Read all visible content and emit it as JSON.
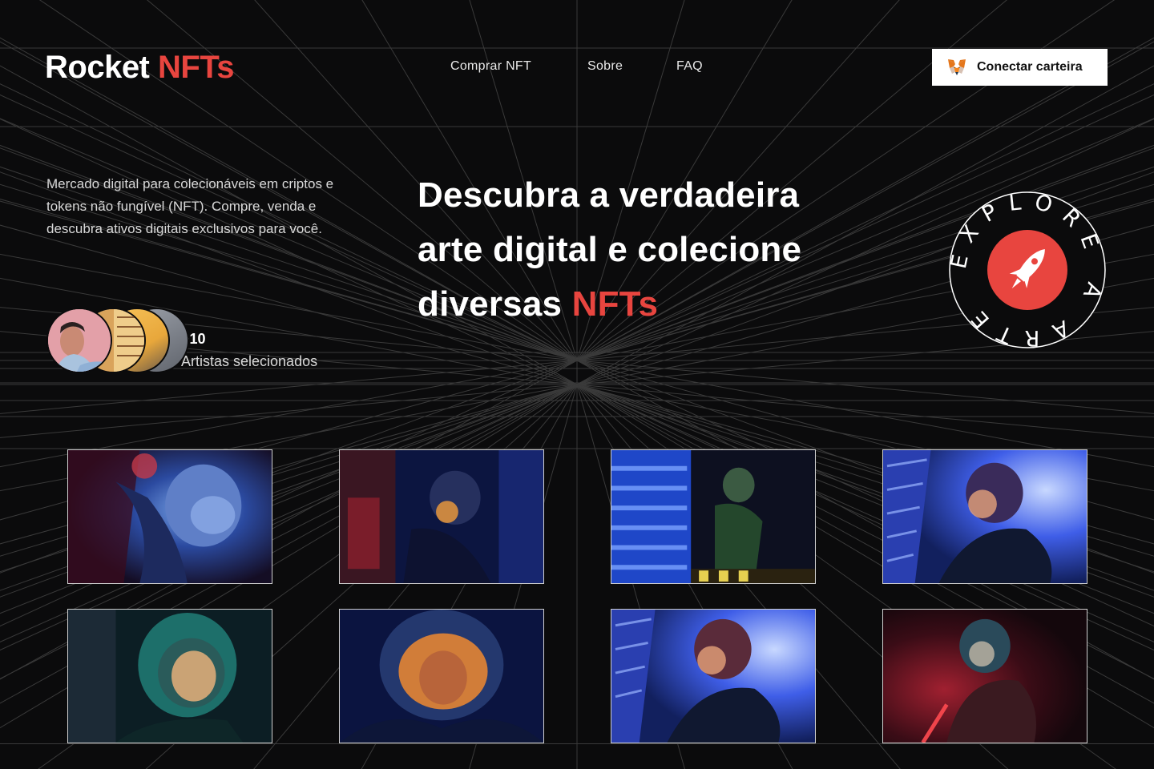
{
  "brand": {
    "name": "Rocket",
    "accent": "NFTs",
    "accent_color": "#e8453f"
  },
  "nav": {
    "items": [
      {
        "label": "Comprar NFT"
      },
      {
        "label": "Sobre"
      },
      {
        "label": "FAQ"
      }
    ]
  },
  "wallet": {
    "label": "Conectar carteira",
    "icon": "metamask-fox-icon"
  },
  "intro": {
    "text": "Mercado digital para colecionáveis em criptos e tokens não fungível (NFT). Compre, venda e descubra ativos digitais exclusivos para você."
  },
  "artists": {
    "count": "+10",
    "label": "Artistas selecionados"
  },
  "hero": {
    "line1": "Descubra a verdadeira",
    "line2": "arte digital e colecione",
    "line3_prefix": "diversas",
    "line3_accent": "NFTs"
  },
  "badge": {
    "text": "EXPLORE A ARTE",
    "icon": "rocket-icon"
  },
  "gallery": {
    "items": [
      {
        "alt": "astronaut-red-blue"
      },
      {
        "alt": "astronaut-dark-blue"
      },
      {
        "alt": "astronaut-green-blue"
      },
      {
        "alt": "astronaut-blue-lights"
      },
      {
        "alt": "astronaut-helmet-teal"
      },
      {
        "alt": "astronaut-helmet-orange"
      },
      {
        "alt": "astronaut-blue-lights-2"
      },
      {
        "alt": "astronaut-red-smoke"
      }
    ]
  },
  "colors": {
    "background": "#0b0b0c",
    "accent": "#e8453f",
    "button_bg": "#ffffff"
  }
}
